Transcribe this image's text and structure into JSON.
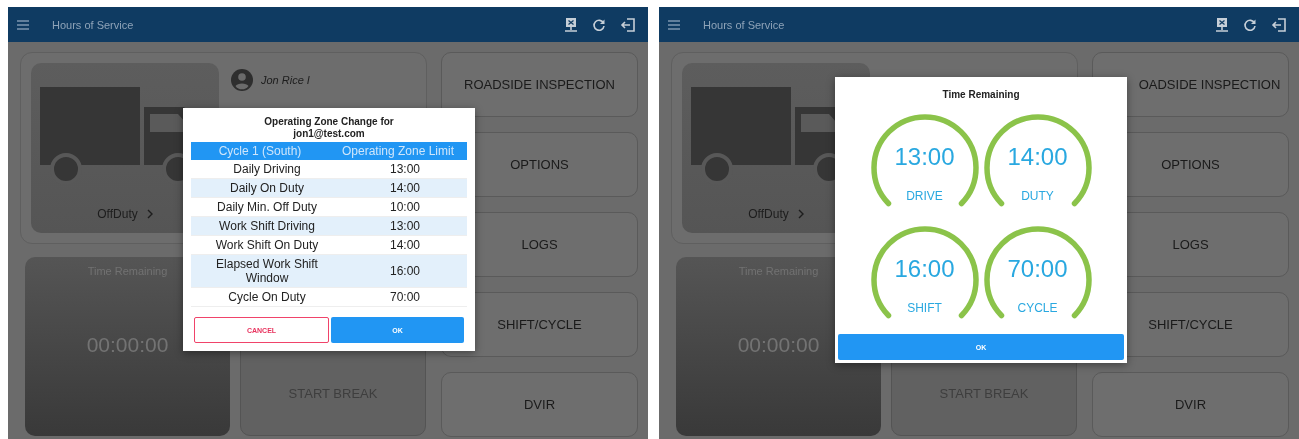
{
  "screens": [
    {
      "app_bar": {
        "title": "Hours of Service"
      },
      "user": {
        "name": "Jon Rice I"
      },
      "status": {
        "label": "OffDuty"
      },
      "timer": {
        "label": "Time Remaining",
        "value": "00:00:00"
      },
      "break_button": "START BREAK",
      "menu_buttons": [
        "ROADSIDE INSPECTION",
        "OPTIONS",
        "LOGS",
        "SHIFT/CYCLE",
        "DVIR"
      ],
      "dialog": {
        "kind": "table",
        "title": "Operating Zone Change for",
        "subtitle": "jon1@test.com",
        "columns": [
          "Cycle 1 (South)",
          "Operating Zone Limit"
        ],
        "rows": [
          {
            "label": "Daily Driving",
            "value": "13:00"
          },
          {
            "label": "Daily On Duty",
            "value": "14:00"
          },
          {
            "label": "Daily Min. Off Duty",
            "value": "10:00"
          },
          {
            "label": "Work Shift Driving",
            "value": "13:00"
          },
          {
            "label": "Work Shift On Duty",
            "value": "14:00"
          },
          {
            "label": "Elapsed Work Shift Window",
            "value": "16:00"
          },
          {
            "label": "Cycle On Duty",
            "value": "70:00"
          }
        ],
        "buttons": [
          {
            "label": "CANCEL",
            "kind": "outline"
          },
          {
            "label": "OK",
            "kind": "primary"
          }
        ]
      }
    },
    {
      "app_bar": {
        "title": "Hours of Service"
      },
      "status": {
        "label": "OffDuty"
      },
      "timer": {
        "label": "Time Remaining",
        "value": "00:00:00"
      },
      "break_button": "START BREAK",
      "menu_buttons": [
        "OADSIDE INSPECTION",
        "OPTIONS",
        "LOGS",
        "SHIFT/CYCLE",
        "DVIR"
      ],
      "dialog": {
        "kind": "gauges",
        "title": "Time Remaining",
        "gauges": [
          {
            "value": "13:00",
            "label": "DRIVE"
          },
          {
            "value": "14:00",
            "label": "DUTY"
          },
          {
            "value": "16:00",
            "label": "SHIFT"
          },
          {
            "value": "70:00",
            "label": "CYCLE"
          }
        ],
        "buttons": [
          {
            "label": "OK",
            "kind": "primary"
          }
        ]
      }
    }
  ]
}
